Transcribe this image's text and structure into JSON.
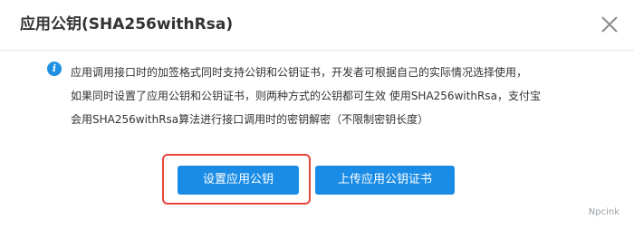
{
  "dialog": {
    "title": "应用公钥(SHA256withRsa)",
    "close_icon": "close-icon"
  },
  "notice": {
    "icon": "info-icon",
    "icon_glyph": "i",
    "lines": [
      "应用调用接口时的加签格式同时支持公钥和公钥证书，开发者可根据自己的实际情况选择使用，",
      "如果同时设置了应用公钥和公钥证书，则两种方式的公钥都可生效 使用SHA256withRsa，支付宝",
      "会用SHA256withRsa算法进行接口调用时的密钥解密（不限制密钥长度）"
    ]
  },
  "actions": {
    "set_public_key_label": "设置应用公钥",
    "upload_cert_label": "上传应用公钥证书"
  },
  "watermark": "Npcink",
  "colors": {
    "primary": "#1a8ce6",
    "highlight_border": "#e8443a",
    "info": "#1e8fe1"
  }
}
